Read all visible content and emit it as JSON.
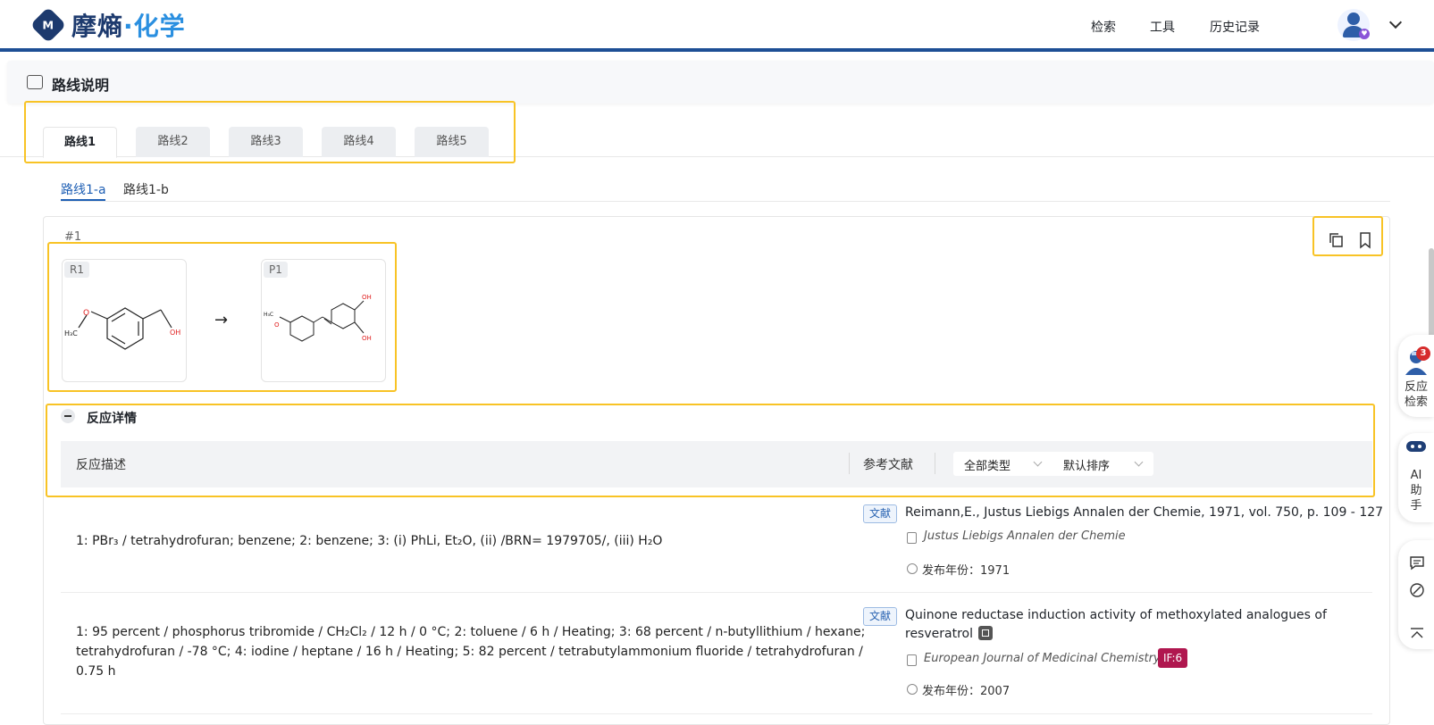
{
  "header": {
    "logo_cn": "摩熵",
    "logo_dot": "·",
    "logo_chem": "化学",
    "nav": [
      "检索",
      "工具",
      "历史记录"
    ]
  },
  "section": {
    "title": "路线说明"
  },
  "route_tabs": [
    "路线1",
    "路线2",
    "路线3",
    "路线4",
    "路线5"
  ],
  "sub_tabs": [
    "路线1-a",
    "路线1-b"
  ],
  "step": {
    "number": "#1",
    "reactant_label": "R1",
    "product_label": "P1",
    "arrow": "→"
  },
  "details": {
    "title": "反应详情",
    "col_desc": "反应描述",
    "col_ref": "参考文献",
    "filter_type": "全部类型",
    "filter_sort": "默认排序"
  },
  "rows": [
    {
      "desc": "1: PBr₃ / tetrahydrofuran; benzene; 2: benzene; 3: (i) PhLi, Et₂O, (ii) /BRN= 1979705/, (iii) H₂O",
      "tag": "文献",
      "ref_title": "Reimann,E., Justus Liebigs Annalen der Chemie, 1971, vol. 750, p. 109 - 127",
      "journal": "Justus Liebigs Annalen der Chemie",
      "year_label": "发布年份：1971"
    },
    {
      "desc_lines": [
        "1: 95 percent / phosphorus tribromide / CH₂Cl₂ / 12 h / 0 °C; 2: toluene / 6 h / Heating; 3: 68 percent / n-butyllithium / hexane;",
        "tetrahydrofuran / -78 °C; 4: iodine / heptane / 16 h / Heating; 5: 82 percent / tetrabutylammonium fluoride / tetrahydrofuran /",
        "0.75 h"
      ],
      "tag": "文献",
      "ref_title_1": "Quinone reductase induction activity of methoxylated analogues of",
      "ref_title_2": "resveratrol",
      "journal": "European Journal of Medicinal Chemistry",
      "impact": "IF:6",
      "year_label": "发布年份：2007"
    }
  ],
  "float": {
    "reaction_search": [
      "反应",
      "检索"
    ],
    "badge": "3",
    "ai": [
      "AI",
      "助",
      "手"
    ]
  },
  "colors": {
    "brand": "#1d3a6e",
    "accent": "#1e5fb4",
    "highlight": "#f8c325",
    "if_badge": "#b0174f"
  }
}
